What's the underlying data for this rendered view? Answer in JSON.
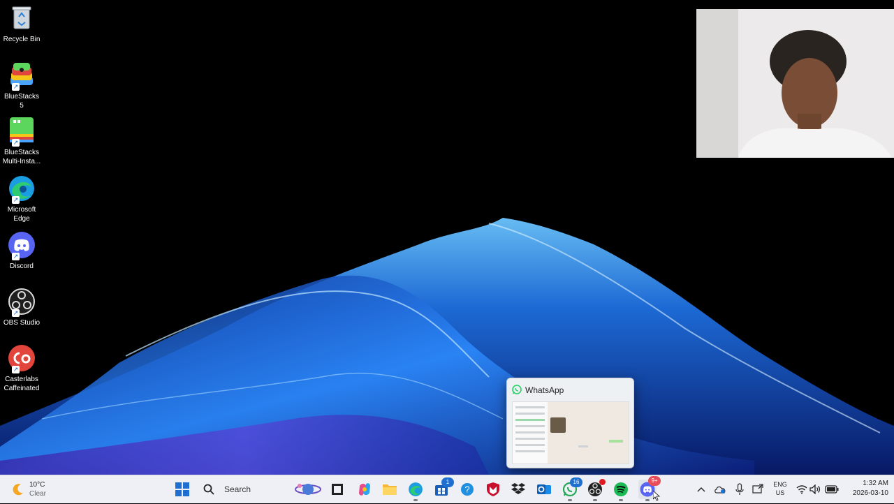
{
  "desktop": {
    "icons": [
      {
        "label": "Recycle Bin"
      },
      {
        "label": "BlueStacks 5"
      },
      {
        "label": "BlueStacks Multi-Insta..."
      },
      {
        "label": "Microsoft Edge"
      },
      {
        "label": "Discord"
      },
      {
        "label": "OBS Studio"
      },
      {
        "label": "Casterlabs Caffeinated"
      }
    ]
  },
  "preview": {
    "title": "WhatsApp"
  },
  "taskbar": {
    "weather": {
      "temp": "10°C",
      "condition": "Clear"
    },
    "search_label": "Search",
    "badges": {
      "store": "1",
      "whatsapp": "16",
      "discord": "9+"
    },
    "language": {
      "line1": "ENG",
      "line2": "US"
    },
    "clock": {
      "time": "1:32 AM",
      "date": "2026-03-10"
    }
  },
  "colors": {
    "taskbar_bg": "#eef0f5",
    "accent": "#1f6fd1",
    "wallpaper_glow": "#3fa2ff"
  }
}
